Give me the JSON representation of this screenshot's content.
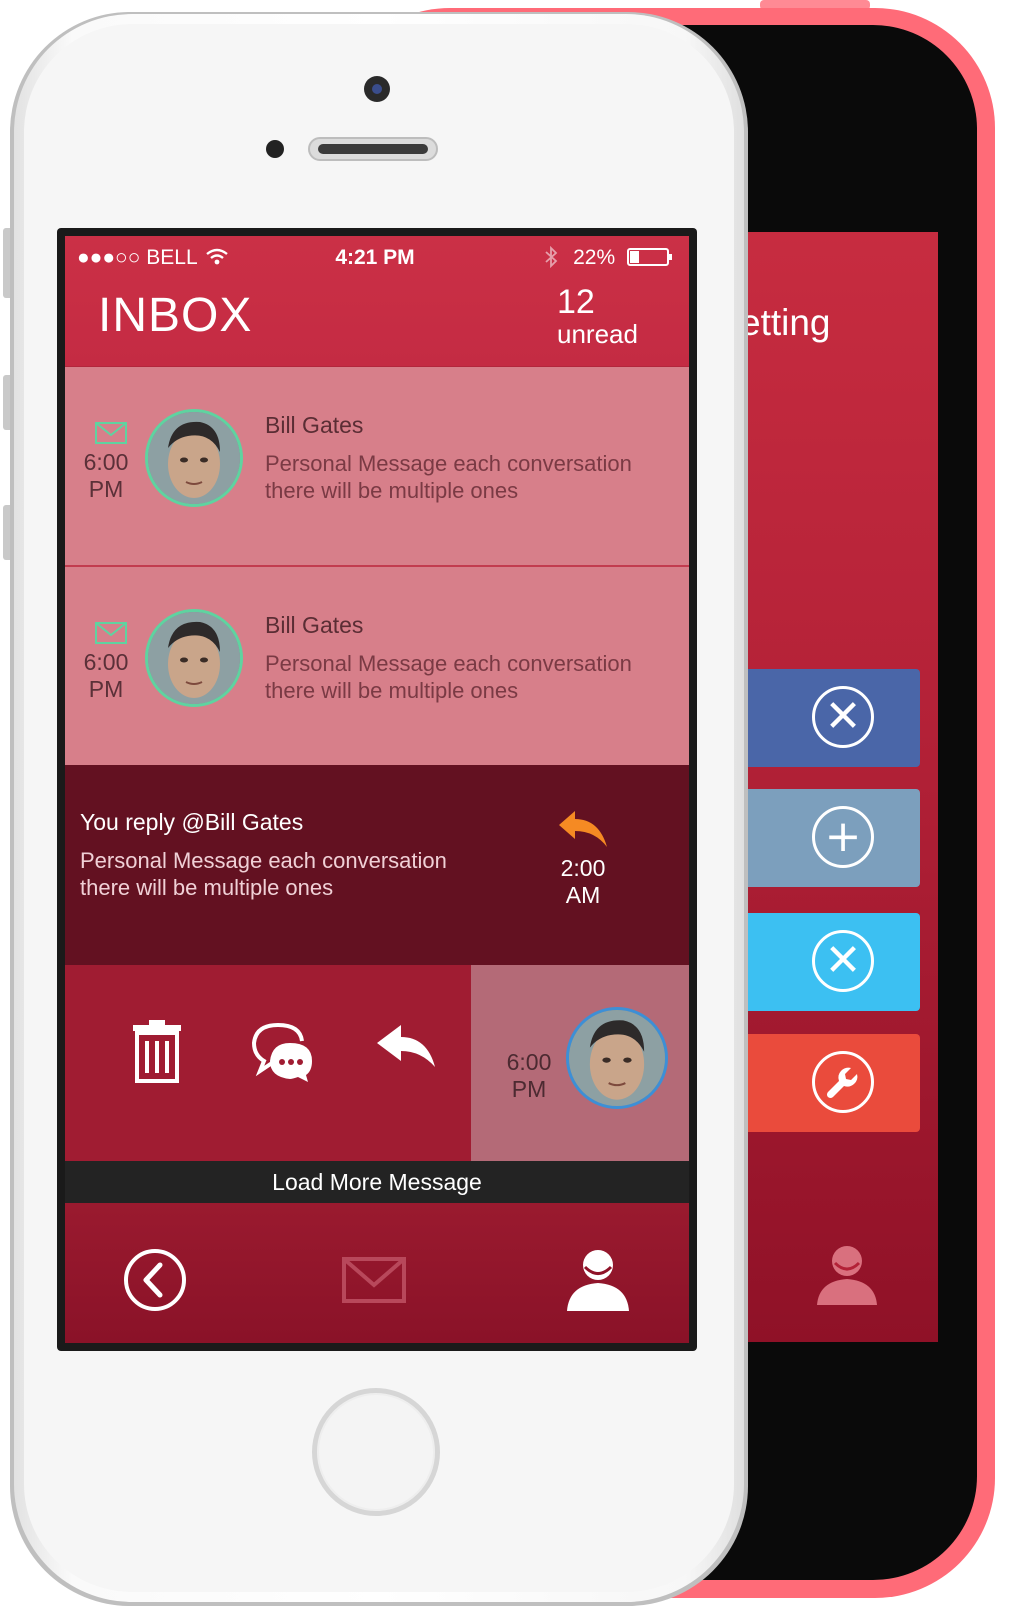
{
  "status_bar": {
    "carrier": "●●●○○ BELL",
    "time": "4:21 PM",
    "battery": "22%"
  },
  "header": {
    "title": "INBOX",
    "unread_count": "12",
    "unread_label": "unread"
  },
  "messages": [
    {
      "time_top": "6:00",
      "time_bottom": "PM",
      "sender": "Bill Gates",
      "body_line1": "Personal Message each conversation",
      "body_line2": "there will be multiple ones"
    },
    {
      "time_top": "6:00",
      "time_bottom": "PM",
      "sender": "Bill Gates",
      "body_line1": "Personal Message each conversation",
      "body_line2": "there will be multiple ones"
    }
  ],
  "reply": {
    "title": "You reply @Bill Gates",
    "body_line1": "Personal Message each conversation",
    "body_line2": "there will be multiple ones",
    "time_top": "2:00",
    "time_bottom": "AM"
  },
  "swipe_row": {
    "time_top": "6:00",
    "time_bottom": "PM",
    "actions": [
      "trash-icon",
      "chat-icon",
      "reply-icon"
    ]
  },
  "load_more": "Load More Message",
  "tab_bar": [
    "back-circle-icon",
    "mail-icon",
    "user-icon"
  ],
  "back_screen": {
    "title": "etting",
    "cards": [
      {
        "color": "#4a66a8",
        "icon": "close-icon",
        "glyph": "✕"
      },
      {
        "color": "#7c9fbd",
        "icon": "plus-icon",
        "glyph": "+"
      },
      {
        "color": "#3cc0f2",
        "icon": "close-icon",
        "glyph": "✕"
      },
      {
        "color": "#ea4b3c",
        "icon": "wrench-icon",
        "glyph": "🔧"
      }
    ]
  },
  "colors": {
    "header": "#c42b43",
    "unread_row": "#d77f8a",
    "reply_row": "#631121",
    "action_row": "#a01c32",
    "accent_orange": "#f58a23",
    "envelope_green": "#5fd3a0"
  }
}
